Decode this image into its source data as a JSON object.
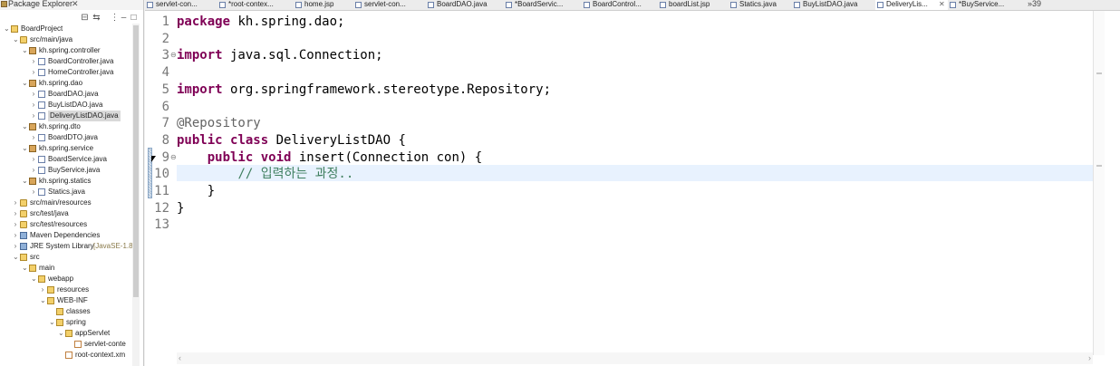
{
  "explorer": {
    "title": "Package Explorer",
    "tree": [
      {
        "label": "BoardProject",
        "icon": "project-icon",
        "toggle": "expanded",
        "depth": 0
      },
      {
        "label": "src/main/java",
        "icon": "source-folder-icon",
        "toggle": "expanded",
        "depth": 1
      },
      {
        "label": "kh.spring.controller",
        "icon": "package-icon",
        "toggle": "expanded",
        "depth": 2
      },
      {
        "label": "BoardController.java",
        "icon": "java-file-icon",
        "toggle": "collapsed",
        "depth": 3
      },
      {
        "label": "HomeController.java",
        "icon": "java-file-icon",
        "toggle": "collapsed",
        "depth": 3
      },
      {
        "label": "kh.spring.dao",
        "icon": "package-icon",
        "toggle": "expanded",
        "depth": 2
      },
      {
        "label": "BoardDAO.java",
        "icon": "java-file-icon",
        "toggle": "collapsed",
        "depth": 3
      },
      {
        "label": "BuyListDAO.java",
        "icon": "java-file-icon",
        "toggle": "collapsed",
        "depth": 3
      },
      {
        "label": "DeliveryListDAO.java",
        "icon": "java-file-icon",
        "toggle": "collapsed",
        "depth": 3,
        "selected": true
      },
      {
        "label": "kh.spring.dto",
        "icon": "package-icon",
        "toggle": "expanded",
        "depth": 2
      },
      {
        "label": "BoardDTO.java",
        "icon": "java-file-icon",
        "toggle": "collapsed",
        "depth": 3
      },
      {
        "label": "kh.spring.service",
        "icon": "package-icon",
        "toggle": "expanded",
        "depth": 2
      },
      {
        "label": "BoardService.java",
        "icon": "java-file-icon",
        "toggle": "collapsed",
        "depth": 3
      },
      {
        "label": "BuyService.java",
        "icon": "java-file-icon",
        "toggle": "collapsed",
        "depth": 3
      },
      {
        "label": "kh.spring.statics",
        "icon": "package-icon",
        "toggle": "expanded",
        "depth": 2
      },
      {
        "label": "Statics.java",
        "icon": "java-file-icon",
        "toggle": "collapsed",
        "depth": 3
      },
      {
        "label": "src/main/resources",
        "icon": "source-folder-icon",
        "toggle": "collapsed",
        "depth": 1
      },
      {
        "label": "src/test/java",
        "icon": "source-folder-icon",
        "toggle": "collapsed",
        "depth": 1
      },
      {
        "label": "src/test/resources",
        "icon": "source-folder-icon",
        "toggle": "collapsed",
        "depth": 1
      },
      {
        "label": "Maven Dependencies",
        "icon": "library-icon",
        "toggle": "collapsed",
        "depth": 1
      },
      {
        "label": "JRE System Library",
        "suffix": "[JavaSE-1.8",
        "icon": "library-icon",
        "toggle": "collapsed",
        "depth": 1
      },
      {
        "label": "src",
        "icon": "folder-icon",
        "toggle": "expanded",
        "depth": 1
      },
      {
        "label": "main",
        "icon": "folder-icon",
        "toggle": "expanded",
        "depth": 2
      },
      {
        "label": "webapp",
        "icon": "folder-icon",
        "toggle": "expanded",
        "depth": 3
      },
      {
        "label": "resources",
        "icon": "folder-icon",
        "toggle": "collapsed",
        "depth": 4
      },
      {
        "label": "WEB-INF",
        "icon": "folder-icon",
        "toggle": "expanded",
        "depth": 4
      },
      {
        "label": "classes",
        "icon": "folder-icon",
        "toggle": "none",
        "depth": 5
      },
      {
        "label": "spring",
        "icon": "folder-icon",
        "toggle": "expanded",
        "depth": 5
      },
      {
        "label": "appServlet",
        "icon": "folder-icon",
        "toggle": "expanded",
        "depth": 6
      },
      {
        "label": "servlet-conte",
        "icon": "xml-file-icon",
        "toggle": "none",
        "depth": 7
      },
      {
        "label": "root-context.xm",
        "icon": "xml-file-icon",
        "toggle": "none",
        "depth": 6
      }
    ]
  },
  "tabs": [
    {
      "label": "servlet-con...",
      "active": false
    },
    {
      "label": "*root-contex...",
      "active": false
    },
    {
      "label": "home.jsp",
      "active": false
    },
    {
      "label": "servlet-con...",
      "active": false
    },
    {
      "label": "BoardDAO.java",
      "active": false
    },
    {
      "label": "*BoardServic...",
      "active": false
    },
    {
      "label": "BoardControl...",
      "active": false
    },
    {
      "label": "boardList.jsp",
      "active": false
    },
    {
      "label": "Statics.java",
      "active": false
    },
    {
      "label": "BuyListDAO.java",
      "active": false
    },
    {
      "label": "DeliveryLis...",
      "active": true
    },
    {
      "label": "*BuyService...",
      "active": false
    }
  ],
  "tab_overflow": "»39",
  "editor": {
    "lines": [
      {
        "n": "1",
        "fold": "",
        "tokens": [
          {
            "t": "package",
            "c": "kw"
          },
          {
            "t": " kh.spring.dao;",
            "c": ""
          }
        ]
      },
      {
        "n": "2",
        "fold": "",
        "tokens": []
      },
      {
        "n": "3",
        "fold": "⊖",
        "tokens": [
          {
            "t": "import",
            "c": "kw"
          },
          {
            "t": " java.sql.Connection;",
            "c": ""
          }
        ]
      },
      {
        "n": "4",
        "fold": "",
        "tokens": []
      },
      {
        "n": "5",
        "fold": "",
        "tokens": [
          {
            "t": "import",
            "c": "kw"
          },
          {
            "t": " org.springframework.stereotype.Repository;",
            "c": ""
          }
        ]
      },
      {
        "n": "6",
        "fold": "",
        "tokens": []
      },
      {
        "n": "7",
        "fold": "",
        "tokens": [
          {
            "t": "@Repository",
            "c": "ann"
          }
        ]
      },
      {
        "n": "8",
        "fold": "",
        "tokens": [
          {
            "t": "public",
            "c": "kw"
          },
          {
            "t": " ",
            "c": ""
          },
          {
            "t": "class",
            "c": "kw"
          },
          {
            "t": " DeliveryListDAO {",
            "c": ""
          }
        ]
      },
      {
        "n": "9",
        "fold": "⊖",
        "tokens": [
          {
            "t": "    ",
            "c": ""
          },
          {
            "t": "public",
            "c": "kw"
          },
          {
            "t": " ",
            "c": ""
          },
          {
            "t": "void",
            "c": "kw"
          },
          {
            "t": " insert(Connection con) {",
            "c": ""
          }
        ]
      },
      {
        "n": "10",
        "fold": "",
        "tokens": [
          {
            "t": "        ",
            "c": ""
          },
          {
            "t": "// 입력하는 과정..",
            "c": "cmt"
          }
        ]
      },
      {
        "n": "11",
        "fold": "",
        "tokens": [
          {
            "t": "    }",
            "c": ""
          }
        ]
      },
      {
        "n": "12",
        "fold": "",
        "tokens": [
          {
            "t": "}",
            "c": ""
          }
        ]
      },
      {
        "n": "13",
        "fold": "",
        "tokens": []
      }
    ]
  },
  "colors": {
    "keyword": "#7f0055",
    "annotation": "#646464",
    "comment": "#3f7f5f",
    "current_line": "#e8f2fe",
    "line_number": "#787878"
  }
}
